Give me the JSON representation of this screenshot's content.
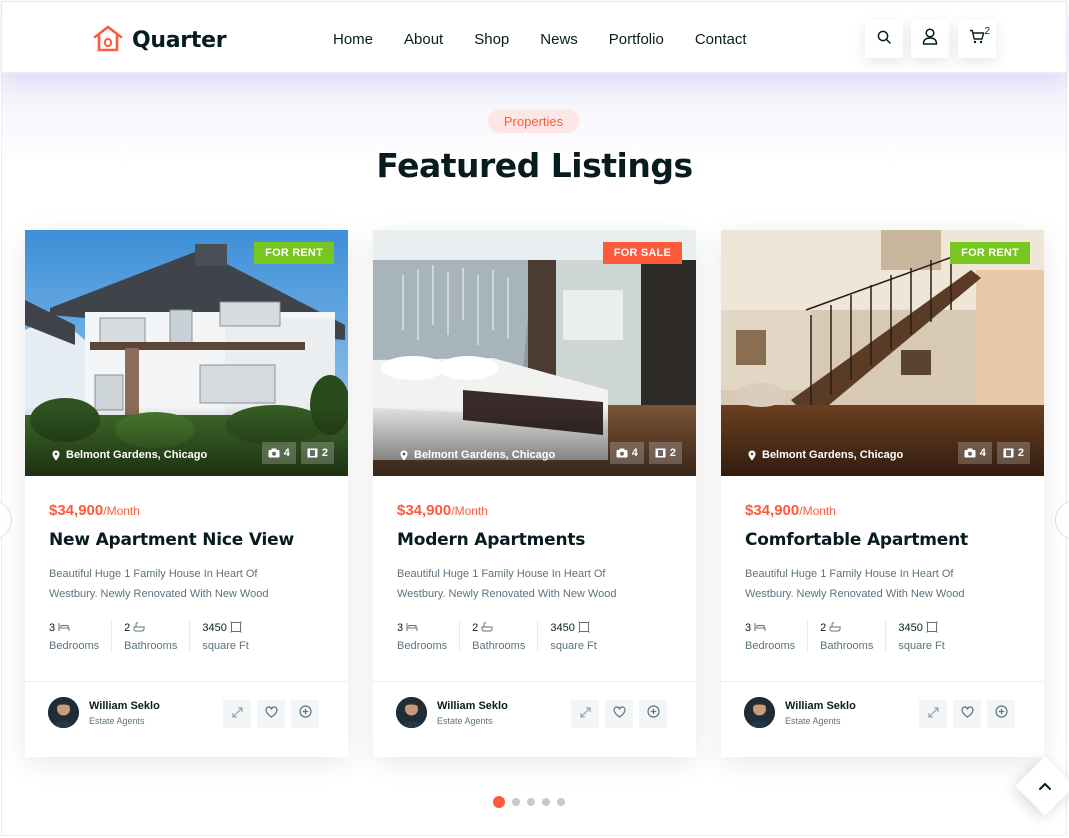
{
  "brand": {
    "name": "Quarter"
  },
  "nav": {
    "items": [
      "Home",
      "About",
      "Shop",
      "News",
      "Portfolio",
      "Contact"
    ]
  },
  "header_actions": {
    "cart_count": "2"
  },
  "section": {
    "badge": "Properties",
    "title": "Featured Listings"
  },
  "colors": {
    "accent": "#ff5a3c",
    "rent": "#77c720",
    "dark": "#071c1f"
  },
  "listings": [
    {
      "tag": "FOR RENT",
      "location": "Belmont Gardens, Chicago",
      "photos": "4",
      "videos": "2",
      "price": "$34,900",
      "period": "/Month",
      "title": "New Apartment Nice View",
      "desc_line1": "Beautiful Huge 1 Family House In Heart Of",
      "desc_line2": "Westbury. Newly Renovated With New Wood",
      "bedrooms_count": "3",
      "bedrooms_label": "Bedrooms",
      "bathrooms_count": "2",
      "bathrooms_label": "Bathrooms",
      "area_value": "3450",
      "area_label": "square Ft",
      "agent_name": "William Seklo",
      "agent_role": "Estate Agents"
    },
    {
      "tag": "FOR SALE",
      "location": "Belmont Gardens, Chicago",
      "photos": "4",
      "videos": "2",
      "price": "$34,900",
      "period": "/Month",
      "title": "Modern Apartments",
      "desc_line1": "Beautiful Huge 1 Family House In Heart Of",
      "desc_line2": "Westbury. Newly Renovated With New Wood",
      "bedrooms_count": "3",
      "bedrooms_label": "Bedrooms",
      "bathrooms_count": "2",
      "bathrooms_label": "Bathrooms",
      "area_value": "3450",
      "area_label": "square Ft",
      "agent_name": "William Seklo",
      "agent_role": "Estate Agents"
    },
    {
      "tag": "FOR RENT",
      "location": "Belmont Gardens, Chicago",
      "photos": "4",
      "videos": "2",
      "price": "$34,900",
      "period": "/Month",
      "title": "Comfortable Apartment",
      "desc_line1": "Beautiful Huge 1 Family House In Heart Of",
      "desc_line2": "Westbury. Newly Renovated With New Wood",
      "bedrooms_count": "3",
      "bedrooms_label": "Bedrooms",
      "bathrooms_count": "2",
      "bathrooms_label": "Bathrooms",
      "area_value": "3450",
      "area_label": "square Ft",
      "agent_name": "William Seklo",
      "agent_role": "Estate Agents"
    }
  ]
}
